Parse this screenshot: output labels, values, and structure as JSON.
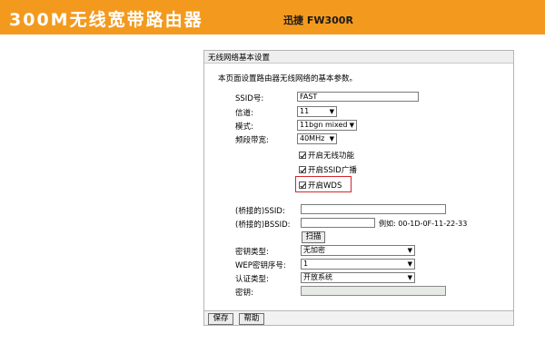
{
  "banner": {
    "title": "300M无线宽带路由器",
    "model": "迅捷 FW300R",
    "color": "#f39a1e"
  },
  "panel": {
    "header": "无线网络基本设置",
    "description": "本页面设置路由器无线网络的基本参数。"
  },
  "form": {
    "ssid": {
      "label": "SSID号:",
      "value": "FAST"
    },
    "channel": {
      "label": "信道:",
      "value": "11"
    },
    "mode": {
      "label": "模式:",
      "value": "11bgn mixed"
    },
    "bandwidth": {
      "label": "频段带宽:",
      "value": "40MHz"
    },
    "enable_wireless": {
      "label": "开启无线功能",
      "checked": true
    },
    "enable_ssid_broadcast": {
      "label": "开启SSID广播",
      "checked": true
    },
    "enable_wds": {
      "label": "开启WDS",
      "checked": true
    },
    "bridged_ssid": {
      "label": "(桥接的)SSID:",
      "value": ""
    },
    "bridged_bssid": {
      "label": "(桥接的)BSSID:",
      "value": "",
      "example": "例如: 00-1D-0F-11-22-33"
    },
    "scan_button": "扫描",
    "key_type": {
      "label": "密钥类型:",
      "value": "无加密"
    },
    "wep_index": {
      "label": "WEP密钥序号:",
      "value": "1"
    },
    "auth_type": {
      "label": "认证类型:",
      "value": "开放系统"
    },
    "key": {
      "label": "密钥:",
      "value": ""
    }
  },
  "footer": {
    "save_button": "保存",
    "help_button": "帮助"
  },
  "colors": {
    "highlight_border": "#d4262d"
  }
}
